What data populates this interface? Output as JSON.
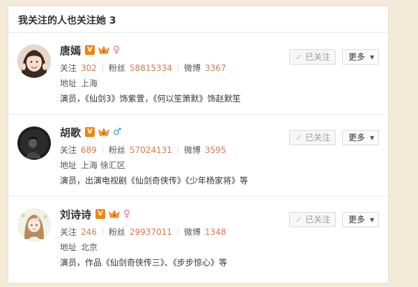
{
  "header": {
    "title": "我关注的人也关注她 3"
  },
  "labels": {
    "follow": "关注",
    "fans": "粉丝",
    "weibo": "微博",
    "address": "地址",
    "followed_button": "已关注",
    "more_button": "更多"
  },
  "people": [
    {
      "name": "唐嫣",
      "verified_badge": "V",
      "gender": "female",
      "gender_symbol": "♀",
      "follow_count": "302",
      "fans_count": "58815334",
      "weibo_count": "3367",
      "address": "上海",
      "intro": "演员，《仙剑3》饰紫萱，《何以笙箫默》饰赵默笙"
    },
    {
      "name": "胡歌",
      "verified_badge": "V",
      "gender": "male",
      "gender_symbol": "♂",
      "follow_count": "689",
      "fans_count": "57024131",
      "weibo_count": "3595",
      "address": "上海 徐汇区",
      "intro": "演员，出演电视剧《仙剑奇侠传》《少年杨家将》等"
    },
    {
      "name": "刘诗诗",
      "verified_badge": "V",
      "gender": "female",
      "gender_symbol": "♀",
      "follow_count": "246",
      "fans_count": "29937011",
      "weibo_count": "1348",
      "address": "北京",
      "intro": "演员，作品《仙剑奇侠传三》、《步步惊心》等"
    }
  ],
  "colors": {
    "background": "#f3ead8",
    "count_accent": "#e2744a",
    "verified": "#f0860d",
    "female": "#ef6fa0",
    "male": "#3a9be7"
  }
}
